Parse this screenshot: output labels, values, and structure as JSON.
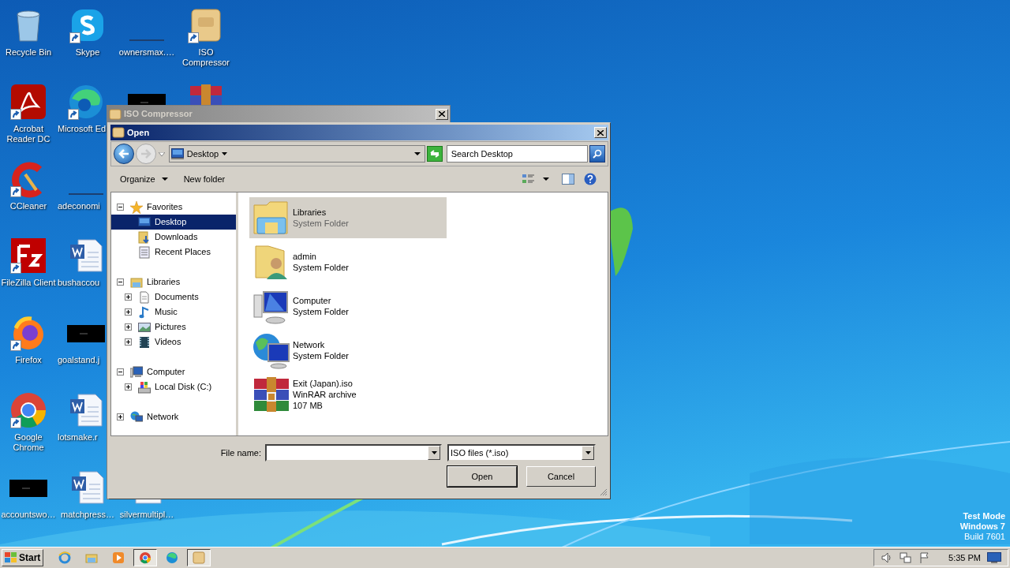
{
  "desktop": {
    "rows": [
      [
        {
          "label": "Recycle Bin",
          "kind": "recycle",
          "shortcut": false
        },
        {
          "label": "Skype",
          "kind": "skype",
          "shortcut": true
        },
        {
          "label": "ownersmax.…",
          "kind": "blank",
          "shortcut": false
        },
        {
          "label": "ISO Compressor",
          "kind": "iso",
          "shortcut": true
        }
      ],
      [
        {
          "label": "Acrobat Reader DC",
          "kind": "acrobat",
          "shortcut": true
        },
        {
          "label": "Microsoft Ed",
          "kind": "edge",
          "shortcut": true
        },
        {
          "kind": "thumbnail"
        },
        {
          "kind": "winrar"
        }
      ],
      [
        {
          "label": "CCleaner",
          "kind": "ccleaner",
          "shortcut": true
        },
        {
          "label": "adeconomi",
          "kind": "blank",
          "shortcut": false
        }
      ],
      [
        {
          "label": "FileZilla Client",
          "kind": "filezilla",
          "shortcut": true
        },
        {
          "label": "bushaccou",
          "kind": "word",
          "shortcut": false
        }
      ],
      [
        {
          "label": "Firefox",
          "kind": "firefox",
          "shortcut": true
        },
        {
          "label": "goalstand.j",
          "kind": "thumbnail",
          "shortcut": false
        }
      ],
      [
        {
          "label": "Google Chrome",
          "kind": "chrome",
          "shortcut": true
        },
        {
          "label": "lotsmake.r",
          "kind": "word",
          "shortcut": false
        }
      ],
      [
        {
          "label": "accountswo…",
          "kind": "thumbnail",
          "shortcut": false
        },
        {
          "label": "matchpress…",
          "kind": "word",
          "shortcut": false
        },
        {
          "label": "silvermultipl…",
          "kind": "doc",
          "shortcut": false
        }
      ]
    ]
  },
  "iso_window": {
    "title": "ISO Compressor"
  },
  "open_dialog": {
    "title": "Open",
    "address": "Desktop",
    "search": {
      "placeholder": "Search Desktop"
    },
    "toolbar": {
      "organize": "Organize",
      "new_folder": "New folder"
    },
    "tree": [
      {
        "label": "Favorites",
        "kind": "star",
        "expanded": true,
        "selected": false,
        "children": [
          {
            "label": "Desktop",
            "kind": "desktop",
            "selected": true
          },
          {
            "label": "Downloads",
            "kind": "downloads",
            "selected": false
          },
          {
            "label": "Recent Places",
            "kind": "recent",
            "selected": false
          }
        ]
      },
      {
        "label": "Libraries",
        "kind": "libraries",
        "expanded": true,
        "selected": false,
        "children": [
          {
            "label": "Documents",
            "kind": "documents",
            "expanded": false,
            "selected": false
          },
          {
            "label": "Music",
            "kind": "music",
            "expanded": false,
            "selected": false
          },
          {
            "label": "Pictures",
            "kind": "pictures",
            "expanded": false,
            "selected": false
          },
          {
            "label": "Videos",
            "kind": "videos",
            "expanded": false,
            "selected": false
          }
        ]
      },
      {
        "label": "Computer",
        "kind": "computer",
        "expanded": true,
        "selected": false,
        "children": [
          {
            "label": "Local Disk (C:)",
            "kind": "disk",
            "expanded": false,
            "selected": false
          }
        ]
      },
      {
        "label": "Network",
        "kind": "network",
        "expanded": false,
        "selected": false
      }
    ],
    "files": [
      {
        "name": "Libraries",
        "details": [
          "System Folder"
        ],
        "kind": "libraries",
        "selected": true
      },
      {
        "name": "admin",
        "details": [
          "System Folder"
        ],
        "kind": "user",
        "selected": false
      },
      {
        "name": "Computer",
        "details": [
          "System Folder"
        ],
        "kind": "computer",
        "selected": false
      },
      {
        "name": "Network",
        "details": [
          "System Folder"
        ],
        "kind": "network",
        "selected": false
      },
      {
        "name": "Exit (Japan).iso",
        "details": [
          "WinRAR archive",
          "107 MB"
        ],
        "kind": "archive",
        "selected": false
      }
    ],
    "file_name": {
      "label": "File name:"
    },
    "file_type": {
      "value": "ISO files (*.iso)"
    },
    "buttons": [
      {
        "label": "Open",
        "default": true
      },
      {
        "label": "Cancel",
        "default": false
      }
    ]
  },
  "taskbar": {
    "start": "Start",
    "apps": [
      {
        "kind": "ie",
        "active": false
      },
      {
        "kind": "explorer",
        "active": false
      },
      {
        "kind": "media",
        "active": false
      },
      {
        "kind": "chrome",
        "active": true
      },
      {
        "kind": "edge",
        "active": false
      },
      {
        "kind": "iso",
        "active": true
      }
    ],
    "clock": "5:35 PM"
  },
  "watermark_text": [
    "Test Mode",
    "Windows 7",
    "Build 7601"
  ]
}
